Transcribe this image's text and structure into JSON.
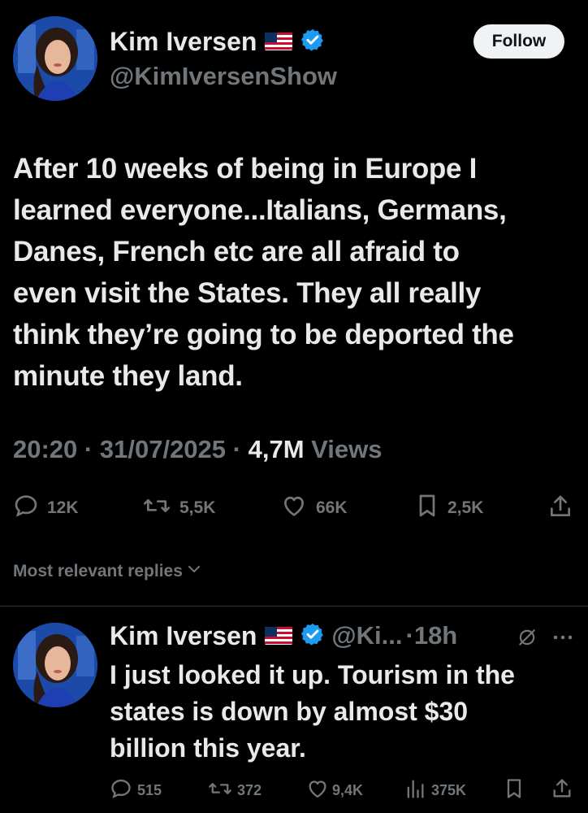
{
  "colors": {
    "background": "#000000",
    "text_primary": "#e7e9ea",
    "text_secondary": "#71767b",
    "verified_blue": "#1d9bf0",
    "divider": "#2f3336"
  },
  "tweet": {
    "author_name": "Kim Iversen",
    "author_handle": "@KimIversenShow",
    "follow_label": "Follow",
    "text_lines": [
      "After 10 weeks of being in Europe I",
      "learned everyone...Italians, Germans,",
      "Danes, French etc are all afraid to",
      "even visit the States. They all really",
      "think they’re going to be deported the",
      "minute they land."
    ],
    "time": "20:20",
    "date": "31/07/2025",
    "views_count": "4,7M",
    "views_label": "Views",
    "separator": "·",
    "actions": {
      "replies": "12K",
      "reposts": "5,5K",
      "likes": "66K",
      "bookmarks": "2,5K"
    }
  },
  "replies_filter": {
    "label": "Most relevant replies"
  },
  "reply": {
    "author_name": "Kim Iversen",
    "author_handle": "@Ki...",
    "separator": "·",
    "age": "18h",
    "text_lines": [
      "I just looked it up. Tourism in the",
      "states is down by almost $30",
      "billion this year."
    ],
    "actions": {
      "replies": "515",
      "reposts": "372",
      "likes": "9,4K",
      "views": "375K"
    }
  },
  "icons": {
    "flag": "us-flag-icon",
    "verified": "verified-badge-icon",
    "reply": "reply-icon",
    "repost": "repost-icon",
    "like": "heart-icon",
    "bookmark": "bookmark-icon",
    "share": "share-icon",
    "views": "views-chart-icon",
    "grok": "grok-icon",
    "more": "more-icon",
    "chevron": "chevron-down-icon"
  }
}
